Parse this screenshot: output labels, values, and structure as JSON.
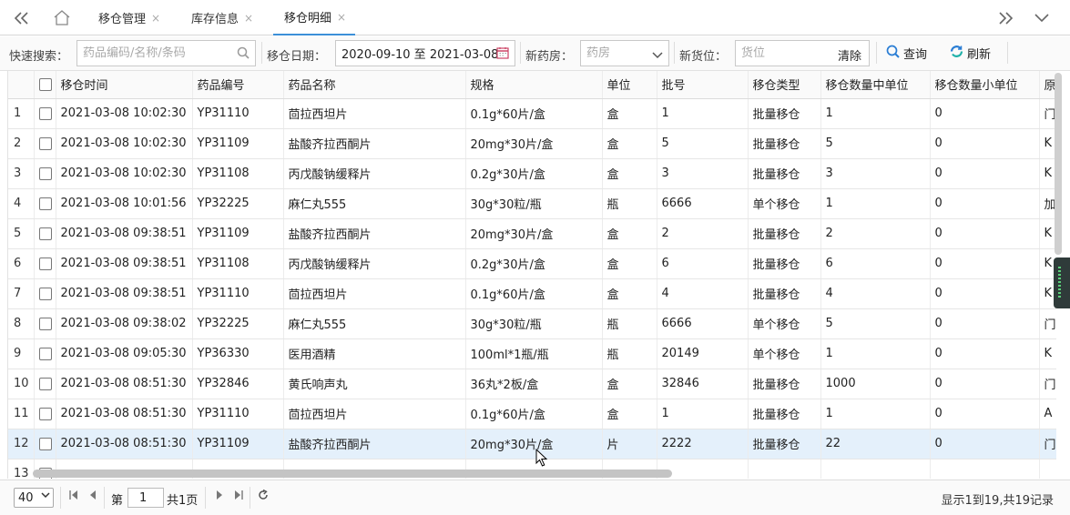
{
  "tabs": [
    {
      "label": "移仓管理",
      "closable": true,
      "active": false
    },
    {
      "label": "库存信息",
      "closable": true,
      "active": false
    },
    {
      "label": "移仓明细",
      "closable": true,
      "active": true
    }
  ],
  "icons": {
    "nav_back": "double-chevron-left",
    "home": "home",
    "close": "×",
    "nav_forward": "double-chevron-right",
    "menu": "chevron-down"
  },
  "toolbar": {
    "quick_search_label": "快速搜索：",
    "quick_search_placeholder": "药品编码/名称/条码",
    "date_label": "移仓日期：",
    "date_value": "2020-09-10 至 2021-03-08",
    "new_pharmacy_label": "新药房：",
    "new_pharmacy_placeholder": "药房",
    "new_location_label": "新货位：",
    "new_location_placeholder": "货位",
    "clear_label": "清除",
    "query_label": "查询",
    "refresh_label": "刷新"
  },
  "table": {
    "columns": [
      "移仓时间",
      "药品编号",
      "药品名称",
      "规格",
      "单位",
      "批号",
      "移仓类型",
      "移仓数量中单位",
      "移仓数量小单位",
      "原"
    ],
    "rows": [
      {
        "n": "1",
        "time": "2021-03-08 10:02:30",
        "code": "YP31110",
        "name": "茴拉西坦片",
        "spec": "0.1g*60片/盒",
        "unit": "盒",
        "batch": "1",
        "type": "批量移仓",
        "mid": "1",
        "small": "0",
        "orig": "门"
      },
      {
        "n": "2",
        "time": "2021-03-08 10:02:30",
        "code": "YP31109",
        "name": "盐酸齐拉西酮片",
        "spec": "20mg*30片/盒",
        "unit": "盒",
        "batch": "5",
        "type": "批量移仓",
        "mid": "5",
        "small": "0",
        "orig": "K"
      },
      {
        "n": "3",
        "time": "2021-03-08 10:02:30",
        "code": "YP31108",
        "name": "丙戊酸钠缓释片",
        "spec": "0.2g*30片/盒",
        "unit": "盒",
        "batch": "3",
        "type": "批量移仓",
        "mid": "3",
        "small": "0",
        "orig": "K"
      },
      {
        "n": "4",
        "time": "2021-03-08 10:01:56",
        "code": "YP32225",
        "name": "麻仁丸555",
        "spec": "30g*30粒/瓶",
        "unit": "瓶",
        "batch": "6666",
        "type": "单个移仓",
        "mid": "1",
        "small": "0",
        "orig": "加"
      },
      {
        "n": "5",
        "time": "2021-03-08 09:38:51",
        "code": "YP31109",
        "name": "盐酸齐拉西酮片",
        "spec": "20mg*30片/盒",
        "unit": "盒",
        "batch": "2",
        "type": "批量移仓",
        "mid": "2",
        "small": "0",
        "orig": "K"
      },
      {
        "n": "6",
        "time": "2021-03-08 09:38:51",
        "code": "YP31108",
        "name": "丙戊酸钠缓释片",
        "spec": "0.2g*30片/盒",
        "unit": "盒",
        "batch": "6",
        "type": "批量移仓",
        "mid": "6",
        "small": "0",
        "orig": "K"
      },
      {
        "n": "7",
        "time": "2021-03-08 09:38:51",
        "code": "YP31110",
        "name": "茴拉西坦片",
        "spec": "0.1g*60片/盒",
        "unit": "盒",
        "batch": "4",
        "type": "批量移仓",
        "mid": "4",
        "small": "0",
        "orig": "K"
      },
      {
        "n": "8",
        "time": "2021-03-08 09:38:02",
        "code": "YP32225",
        "name": "麻仁丸555",
        "spec": "30g*30粒/瓶",
        "unit": "瓶",
        "batch": "6666",
        "type": "单个移仓",
        "mid": "5",
        "small": "0",
        "orig": "门"
      },
      {
        "n": "9",
        "time": "2021-03-08 09:05:30",
        "code": "YP36330",
        "name": "医用酒精",
        "spec": "100ml*1瓶/瓶",
        "unit": "瓶",
        "batch": "20149",
        "type": "单个移仓",
        "mid": "1",
        "small": "0",
        "orig": "K"
      },
      {
        "n": "10",
        "time": "2021-03-08 08:51:30",
        "code": "YP32846",
        "name": "黄氏响声丸",
        "spec": "36丸*2板/盒",
        "unit": "盒",
        "batch": "32846",
        "type": "批量移仓",
        "mid": "1000",
        "small": "0",
        "orig": "门"
      },
      {
        "n": "11",
        "time": "2021-03-08 08:51:30",
        "code": "YP31110",
        "name": "茴拉西坦片",
        "spec": "0.1g*60片/盒",
        "unit": "盒",
        "batch": "1",
        "type": "批量移仓",
        "mid": "1",
        "small": "0",
        "orig": "A"
      },
      {
        "n": "12",
        "time": "2021-03-08 08:51:30",
        "code": "YP31109",
        "name": "盐酸齐拉西酮片",
        "spec": "20mg*30片/盒",
        "unit": "片",
        "batch": "2222",
        "type": "批量移仓",
        "mid": "22",
        "small": "0",
        "orig": "门",
        "selected": true
      },
      {
        "n": "13",
        "time": "",
        "code": "",
        "name": "",
        "spec": "",
        "unit": "",
        "batch": "",
        "type": "",
        "mid": "",
        "small": "",
        "orig": ""
      }
    ]
  },
  "footer": {
    "page_size": "40",
    "page_prefix": "第",
    "page_current": "1",
    "page_total": "共1页",
    "summary": "显示1到19,共19记录"
  }
}
